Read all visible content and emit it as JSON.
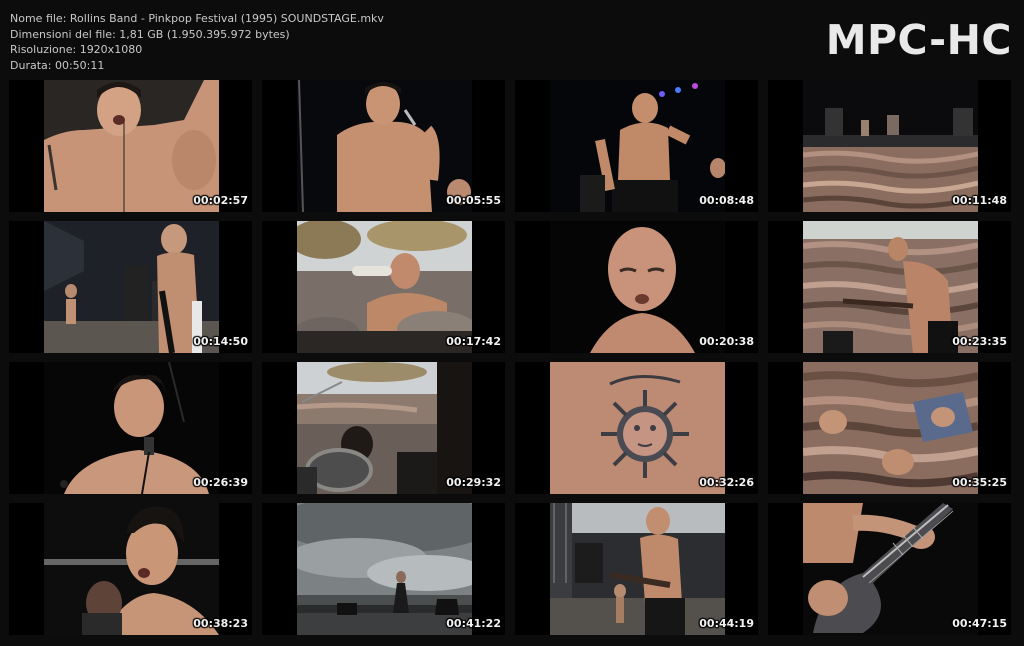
{
  "info": {
    "filename": "Nome file: Rollins Band - Pinkpop Festival (1995) SOUNDSTAGE.mkv",
    "filesize": "Dimensioni del file: 1,81 GB (1.950.395.972 bytes)",
    "resolution": "Risoluzione: 1920x1080",
    "duration": "Durata: 00:50:11"
  },
  "logo": "MPC-HC",
  "thumbs": [
    {
      "time": "00:02:57"
    },
    {
      "time": "00:05:55"
    },
    {
      "time": "00:08:48"
    },
    {
      "time": "00:11:48"
    },
    {
      "time": "00:14:50"
    },
    {
      "time": "00:17:42"
    },
    {
      "time": "00:20:38"
    },
    {
      "time": "00:23:35"
    },
    {
      "time": "00:26:39"
    },
    {
      "time": "00:29:32"
    },
    {
      "time": "00:32:26"
    },
    {
      "time": "00:35:25"
    },
    {
      "time": "00:38:23"
    },
    {
      "time": "00:41:22"
    },
    {
      "time": "00:44:19"
    },
    {
      "time": "00:47:15"
    }
  ]
}
